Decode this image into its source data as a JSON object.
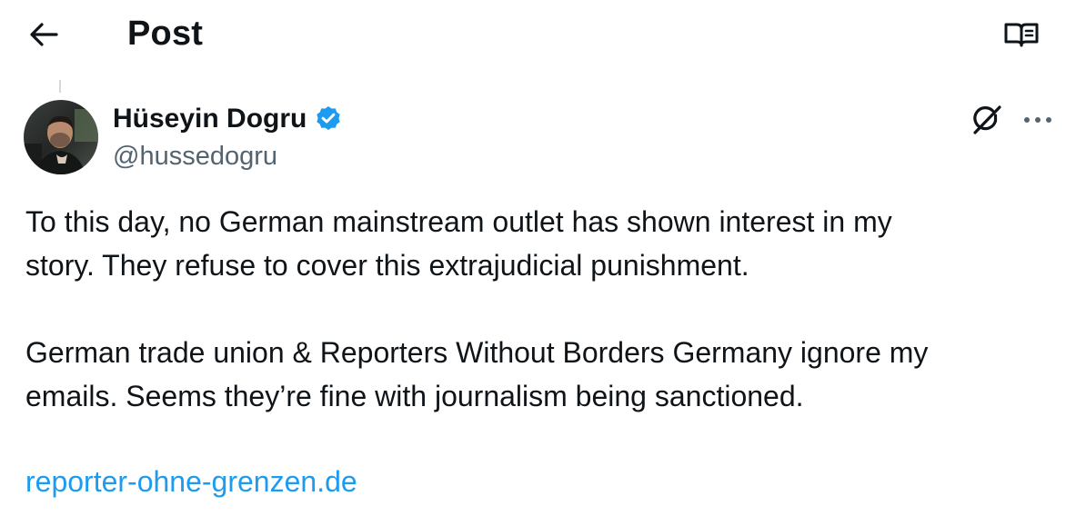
{
  "header": {
    "title": "Post"
  },
  "post": {
    "author": {
      "name": "Hüseyin Dogru",
      "handle": "@hussedogru",
      "verified": true
    },
    "paragraphs": [
      {
        "lines": [
          "To this day, no German mainstream outlet has shown interest in my",
          "story. They refuse to cover this extrajudicial punishment."
        ]
      },
      {
        "lines": [
          "German trade union & Reporters Without Borders Germany ignore my",
          "emails. Seems they’re fine with journalism being sanctioned."
        ]
      }
    ],
    "link": "reporter-ohne-grenzen.de"
  },
  "icons": {
    "back": "arrow-left-icon",
    "reader": "open-book-icon",
    "verified": "verified-badge-icon",
    "grok": "grok-icon",
    "more": "more-horizontal-icon"
  },
  "colors": {
    "text": "#0f1419",
    "secondary": "#536471",
    "link": "#1d9bf0",
    "verified": "#1d9bf0"
  }
}
